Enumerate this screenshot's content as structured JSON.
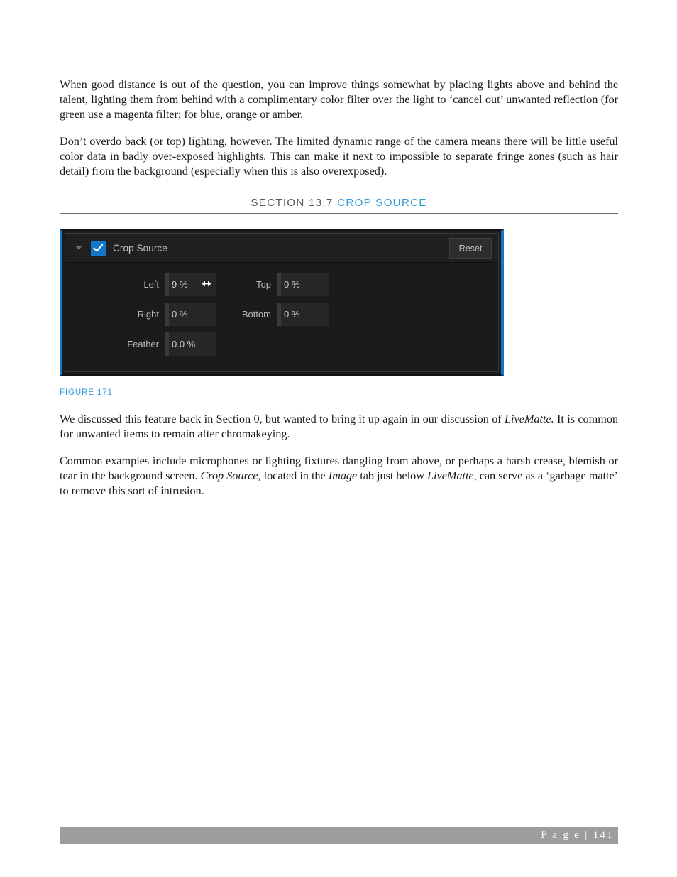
{
  "document": {
    "paragraphs_before": [
      "When good distance is out of the question, you can improve things somewhat by placing lights above and behind the talent, lighting them from behind with a complimentary color filter over the light to ‘cancel out’ unwanted reflection (for green use a magenta filter; for blue, orange or amber.",
      "Don’t overdo back (or top) lighting, however.  The limited dynamic range of the camera means there will be little useful color data in badly over-exposed highlights.  This can make it next to impossible to separate fringe zones (such as hair detail) from the background (especially when this is also overexposed)."
    ],
    "section": {
      "label": "SECTION 13.7",
      "title": "CROP SOURCE",
      "label_color": "#595959",
      "title_color": "#2e9bd6"
    },
    "figure_caption": "FIGURE 171",
    "paragraphs_after": [
      {
        "runs": [
          {
            "text": "We discussed this feature back in Section 0, but wanted to bring it up again in our discussion of ",
            "style": "normal"
          },
          {
            "text": "LiveMatte.",
            "style": "italic"
          },
          {
            "text": " It is common for unwanted items to remain after chromakeying.",
            "style": "normal"
          }
        ]
      },
      {
        "runs": [
          {
            "text": "Common examples include microphones or lighting fixtures dangling from above, or perhaps a harsh crease, blemish or tear in the background screen.  ",
            "style": "normal"
          },
          {
            "text": "Crop Source",
            "style": "italic"
          },
          {
            "text": ", located in the ",
            "style": "normal"
          },
          {
            "text": "Image",
            "style": "italic"
          },
          {
            "text": " tab just below ",
            "style": "normal"
          },
          {
            "text": "LiveMatte",
            "style": "italic"
          },
          {
            "text": ", can serve as a ‘garbage matte’ to remove this sort of intrusion.",
            "style": "normal"
          }
        ]
      }
    ],
    "footer": {
      "text": "P a g e  | 141",
      "bar_color": "#9d9d9d"
    }
  },
  "crop_panel": {
    "title": "Crop Source",
    "enabled": true,
    "reset_label": "Reset",
    "accent_color": "#1477c4",
    "checkbox_color": "#1277c8",
    "fields": [
      {
        "label": "Left",
        "value": "9 %",
        "column": "left",
        "row": 1,
        "has_resize_cursor": true
      },
      {
        "label": "Top",
        "value": "0 %",
        "column": "right",
        "row": 1,
        "has_resize_cursor": false
      },
      {
        "label": "Right",
        "value": "0 %",
        "column": "left",
        "row": 2,
        "has_resize_cursor": false
      },
      {
        "label": "Bottom",
        "value": "0 %",
        "column": "right",
        "row": 2,
        "has_resize_cursor": false
      },
      {
        "label": "Feather",
        "value": "0.0 %",
        "column": "left",
        "row": 3,
        "has_resize_cursor": false
      }
    ]
  }
}
